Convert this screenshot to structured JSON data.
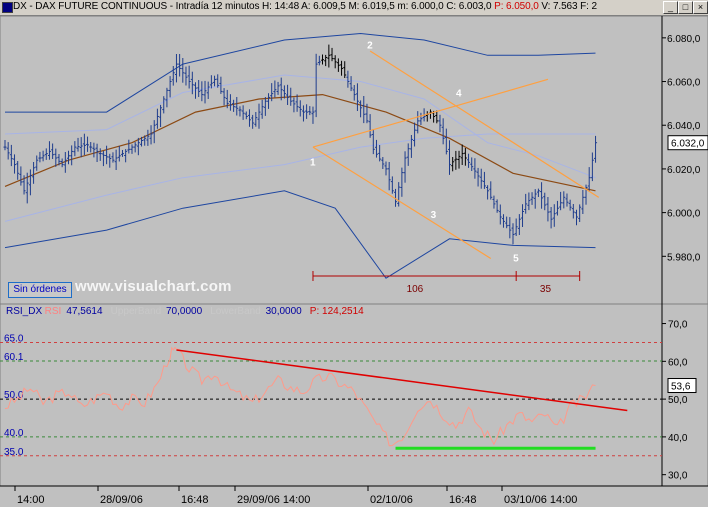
{
  "titlebar": {
    "icon": "chart-window-icon",
    "segments": [
      {
        "text": "DX - DAX FUTURE CONTINUOUS - Intradía 12 minutos  H: 14:48  A: 6.009,5  M: 6.019,5  m: 6.000,0  C: 6.003,0  ",
        "color": "#000000"
      },
      {
        "text": "P: 6.050,0",
        "color": "#d00000"
      },
      {
        "text": "  V: 7.563  F: 2",
        "color": "#000000"
      }
    ],
    "buttons": [
      "_",
      "□",
      "×"
    ]
  },
  "price_panel": {
    "last_price_label": "6.032,0",
    "pattern_labels": [
      "1",
      "2",
      "3",
      "4",
      "5"
    ],
    "measure_labels": [
      "106",
      "35"
    ]
  },
  "rsi_panel": {
    "header": [
      {
        "text": "RSI_DX",
        "color": "#0000a0"
      },
      {
        "text": "RSI",
        "color": "#ff8080"
      },
      {
        "text": "47,5614",
        "color": "#0000a0"
      },
      {
        "text": "UpperBand",
        "color": "#c8c8c8"
      },
      {
        "text": "70,0000",
        "color": "#0000a0"
      },
      {
        "text": "LowerBand",
        "color": "#c8c8c8"
      },
      {
        "text": "30,0000",
        "color": "#0000a0"
      },
      {
        "text": "P: 124,2514",
        "color": "#d00000"
      }
    ],
    "level_labels": [
      "65.0",
      "60.1",
      "50.0",
      "40.0",
      "35.0"
    ],
    "last_rsi_label": "53,6"
  },
  "orders_button": "Sin órdenes",
  "watermark": "www.visualchart.com",
  "colors": {
    "background": "#c0c0c0",
    "candles": "#1e3c8c",
    "highlight_candles": "#000000",
    "bollinger_outer": "#1e46a0",
    "bollinger_inner": "#a8b4e6",
    "moving_average": "#8c4a14",
    "channel_lines": "#ffa040",
    "rsi_line": "#ff9a8a",
    "rsi_trend": "#e00000",
    "rsi_support": "#22dd22",
    "measure": "#b00000"
  },
  "chart_data": [
    {
      "type": "candlestick",
      "title": "DX - DAX FUTURE CONTINUOUS - Intradía 12 minutos",
      "timeframe": "12 minutos",
      "ylim": [
        5960,
        6090
      ],
      "y_ticks": [
        "6.080,0",
        "6.060,0",
        "6.040,0",
        "6.020,0",
        "6.000,0",
        "5.980,0"
      ],
      "y_tick_values": [
        6080,
        6060,
        6040,
        6020,
        6000,
        5980
      ],
      "x_ticks": [
        "14:00",
        "28/09/06",
        "16:48",
        "29/09/06 14:00",
        "02/10/06",
        "16:48",
        "03/10/06 14:00"
      ],
      "last": {
        "H": "14:48",
        "A": 6009.5,
        "M": 6019.5,
        "m": 6000.0,
        "C": 6003.0,
        "P": 6050.0,
        "V": 7563
      },
      "close_path": [
        [
          0,
          6030
        ],
        [
          1.5,
          6022
        ],
        [
          3,
          6010
        ],
        [
          5,
          6024
        ],
        [
          7,
          6028
        ],
        [
          9,
          6022
        ],
        [
          11,
          6030
        ],
        [
          13,
          6031
        ],
        [
          15,
          6027
        ],
        [
          17,
          6024
        ],
        [
          19,
          6028
        ],
        [
          21,
          6032
        ],
        [
          23,
          6036
        ],
        [
          25,
          6052
        ],
        [
          27,
          6068
        ],
        [
          29,
          6060
        ],
        [
          31,
          6054
        ],
        [
          33,
          6061
        ],
        [
          35,
          6050
        ],
        [
          37,
          6047
        ],
        [
          39,
          6041
        ],
        [
          41,
          6051
        ],
        [
          43,
          6058
        ],
        [
          45,
          6051
        ],
        [
          47,
          6046
        ],
        [
          48.5,
          6046
        ],
        [
          49,
          6068
        ],
        [
          51,
          6072
        ],
        [
          53,
          6066
        ],
        [
          55,
          6054
        ],
        [
          57,
          6042
        ],
        [
          58,
          6029
        ],
        [
          60,
          6020
        ],
        [
          61.5,
          6005
        ],
        [
          63,
          6025
        ],
        [
          65,
          6042
        ],
        [
          67,
          6046
        ],
        [
          68.5,
          6040
        ],
        [
          70,
          6022
        ],
        [
          72,
          6027
        ],
        [
          74,
          6019
        ],
        [
          76,
          6010
        ],
        [
          78,
          5998
        ],
        [
          80,
          5990
        ],
        [
          82,
          6004
        ],
        [
          84,
          6010
        ],
        [
          86,
          5997
        ],
        [
          88,
          6007
        ],
        [
          90,
          5998
        ],
        [
          92,
          6016
        ],
        [
          93,
          6032
        ]
      ],
      "bollinger": {
        "upper_outer": [
          [
            0,
            6046
          ],
          [
            16,
            6046
          ],
          [
            28,
            6068
          ],
          [
            44,
            6079
          ],
          [
            56,
            6082
          ],
          [
            66,
            6079
          ],
          [
            76,
            6072
          ],
          [
            84,
            6072
          ],
          [
            93,
            6073
          ]
        ],
        "lower_outer": [
          [
            0,
            5984
          ],
          [
            16,
            5992
          ],
          [
            28,
            6002
          ],
          [
            44,
            6010
          ],
          [
            52,
            6002
          ],
          [
            60,
            5970
          ],
          [
            70,
            5988
          ],
          [
            80,
            5985
          ],
          [
            93,
            5984
          ]
        ],
        "upper_inner": [
          [
            0,
            6036
          ],
          [
            16,
            6038
          ],
          [
            28,
            6055
          ],
          [
            44,
            6063
          ],
          [
            56,
            6060
          ],
          [
            66,
            6052
          ],
          [
            76,
            6032
          ],
          [
            84,
            6026
          ],
          [
            93,
            6016
          ]
        ],
        "lower_inner": [
          [
            0,
            5996
          ],
          [
            16,
            6008
          ],
          [
            28,
            6016
          ],
          [
            44,
            6022
          ],
          [
            56,
            6030
          ],
          [
            66,
            6034
          ],
          [
            76,
            6036
          ],
          [
            84,
            6036
          ],
          [
            93,
            6036
          ]
        ]
      },
      "moving_average": [
        [
          0,
          6012
        ],
        [
          10,
          6024
        ],
        [
          20,
          6032
        ],
        [
          30,
          6046
        ],
        [
          40,
          6052
        ],
        [
          50,
          6054
        ],
        [
          60,
          6046
        ],
        [
          70,
          6034
        ],
        [
          80,
          6018
        ],
        [
          93,
          6010
        ]
      ],
      "channel_lines": [
        {
          "from": [
            48.5,
            6030
          ],
          "to": [
            76.5,
            5979
          ]
        },
        {
          "from": [
            48.5,
            6030
          ],
          "to": [
            85.5,
            6061
          ]
        },
        {
          "from": [
            57.5,
            6074
          ],
          "to": [
            93.5,
            6007
          ]
        }
      ],
      "pattern_points": [
        {
          "label": "1",
          "x": 48.5,
          "y": 6028
        },
        {
          "label": "2",
          "x": 57.5,
          "y": 6072
        },
        {
          "label": "3",
          "x": 67.5,
          "y": 6004
        },
        {
          "label": "4",
          "x": 71.5,
          "y": 6050
        },
        {
          "label": "5",
          "x": 80.5,
          "y": 5984
        }
      ],
      "measures": [
        {
          "label": "106",
          "from": 48.5,
          "to": 80.5
        },
        {
          "label": "35",
          "from": 80.5,
          "to": 90.5
        }
      ]
    },
    {
      "type": "line",
      "title": "RSI_DX",
      "series": [
        {
          "name": "RSI",
          "last": 47.5614
        }
      ],
      "upper_band": 70.0,
      "lower_band": 30.0,
      "P": 124.2514,
      "ylim": [
        27,
        72
      ],
      "y_ticks": [
        "70,0",
        "60,0",
        "50,0",
        "40,0",
        "30,0"
      ],
      "y_tick_values": [
        70,
        60,
        50,
        40,
        30
      ],
      "levels": [
        {
          "label": "65.0",
          "value": 65.0,
          "color": "#d04040",
          "dash": "dashed"
        },
        {
          "label": "60.1",
          "value": 60.1,
          "color": "#3a8a3a",
          "dash": "dashed"
        },
        {
          "label": "50.0",
          "value": 50.0,
          "color": "#000000",
          "dash": "dashed"
        },
        {
          "label": "40.0",
          "value": 40.0,
          "color": "#3a8a3a",
          "dash": "dashed"
        },
        {
          "label": "35.0",
          "value": 35.0,
          "color": "#d04040",
          "dash": "dashed"
        }
      ],
      "rsi_path": [
        [
          0,
          48
        ],
        [
          2,
          50
        ],
        [
          4,
          53
        ],
        [
          6,
          49
        ],
        [
          8,
          51
        ],
        [
          10,
          52
        ],
        [
          12,
          48
        ],
        [
          14,
          50
        ],
        [
          16,
          52
        ],
        [
          18,
          48
        ],
        [
          20,
          50
        ],
        [
          22,
          49
        ],
        [
          24,
          54
        ],
        [
          26,
          62
        ],
        [
          27,
          63
        ],
        [
          29,
          58
        ],
        [
          31,
          55
        ],
        [
          33,
          57
        ],
        [
          35,
          53
        ],
        [
          37,
          51
        ],
        [
          39,
          49
        ],
        [
          41,
          52
        ],
        [
          43,
          55
        ],
        [
          45,
          53
        ],
        [
          47,
          52
        ],
        [
          49,
          55
        ],
        [
          51,
          56
        ],
        [
          53,
          54
        ],
        [
          55,
          52
        ],
        [
          57,
          47
        ],
        [
          59,
          42
        ],
        [
          61,
          38
        ],
        [
          63,
          41
        ],
        [
          65,
          48
        ],
        [
          67,
          50
        ],
        [
          69,
          46
        ],
        [
          71,
          43
        ],
        [
          73,
          47
        ],
        [
          75,
          42
        ],
        [
          77,
          39
        ],
        [
          79,
          43
        ],
        [
          81,
          46
        ],
        [
          83,
          44
        ],
        [
          85,
          46
        ],
        [
          87,
          42
        ],
        [
          89,
          48
        ],
        [
          91,
          50
        ],
        [
          93,
          53.6
        ]
      ],
      "trend_line": {
        "from": [
          27,
          63
        ],
        "to": [
          98,
          47
        ]
      },
      "support_line": {
        "from": [
          61.5,
          37
        ],
        "to": [
          93,
          37
        ]
      },
      "last_label_value": 53.6
    }
  ]
}
